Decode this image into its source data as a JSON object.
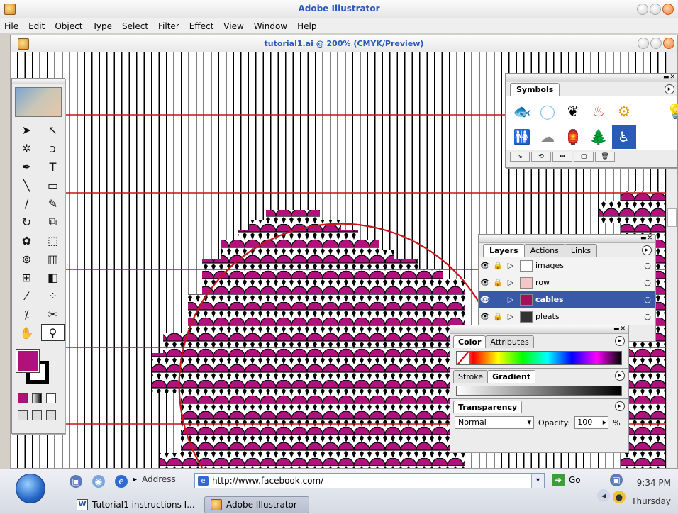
{
  "app": {
    "title": "Adobe Illustrator"
  },
  "menu": [
    "File",
    "Edit",
    "Object",
    "Type",
    "Select",
    "Filter",
    "Effect",
    "View",
    "Window",
    "Help"
  ],
  "document": {
    "title": "tutorial1.ai @ 200% (CMYK/Preview)"
  },
  "symbols": {
    "tab": "Symbols",
    "items": [
      "fish-symbol",
      "sphere-symbol",
      "grass-symbol",
      "fire-symbol",
      "gear-symbol",
      "blank-symbol",
      "lightbulb-symbol",
      "restroom-symbol",
      "smoke-symbol",
      "lantern-symbol",
      "tree-symbol",
      "wheelchair-symbol"
    ]
  },
  "layers": {
    "tabs": [
      "Layers",
      "Actions",
      "Links"
    ],
    "rows": [
      {
        "name": "images",
        "selected": false
      },
      {
        "name": "row",
        "selected": false
      },
      {
        "name": "cables",
        "selected": true
      },
      {
        "name": "pleats",
        "selected": false
      }
    ]
  },
  "color_panel": {
    "tabs": [
      "Color",
      "Attributes"
    ]
  },
  "gradient_panel": {
    "tabs": [
      "Stroke",
      "Gradient"
    ]
  },
  "transparency_panel": {
    "tab": "Transparency",
    "mode": "Normal",
    "opacity_label": "Opacity:",
    "opacity_value": "100",
    "percent": "%"
  },
  "taskbar": {
    "address_label": "Address",
    "url": "http://www.facebook.com/",
    "go_label": "Go",
    "tasks": [
      {
        "label": "Tutorial1 instructions I...",
        "active": false
      },
      {
        "label": "Adobe Illustrator",
        "active": true
      }
    ],
    "time": "9:34 PM",
    "day": "Thursday"
  },
  "colors": {
    "fill": "#b0117c",
    "guide": "#c8141c",
    "selection": "#3a58a8"
  }
}
